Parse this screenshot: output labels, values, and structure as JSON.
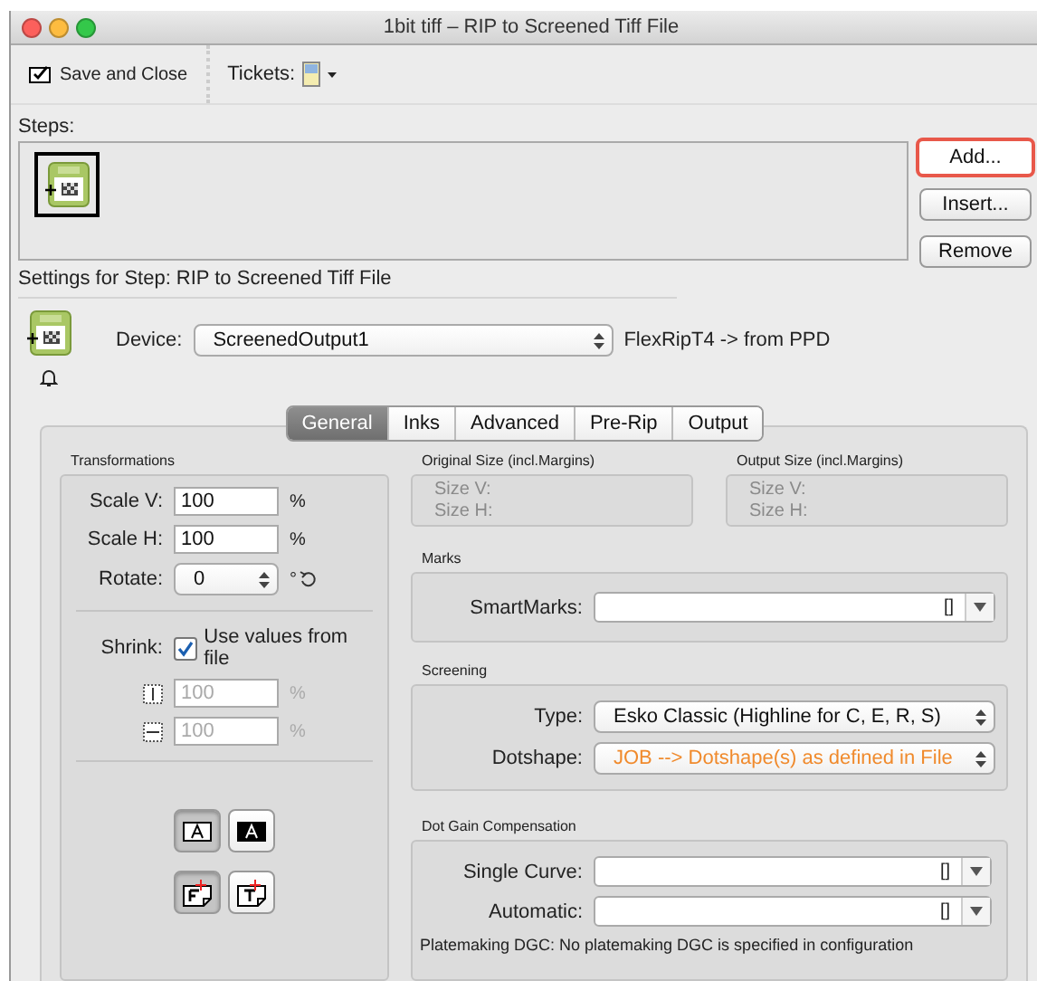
{
  "window": {
    "title": "1bit tiff – RIP to Screened Tiff File"
  },
  "toolbar": {
    "save_close": "Save and Close",
    "tickets": "Tickets:"
  },
  "steps": {
    "label": "Steps:",
    "items": [
      {
        "selected": true
      }
    ],
    "buttons": [
      {
        "label": "Add...",
        "highlighted": true
      },
      {
        "label": "Insert...",
        "highlighted": false
      },
      {
        "label": "Remove",
        "highlighted": false
      }
    ]
  },
  "settings_title": "Settings for Step: RIP to Screened Tiff File",
  "device": {
    "label": "Device:",
    "value": "ScreenedOutput1",
    "note": "FlexRipT4 -> from PPD"
  },
  "tabs": [
    {
      "label": "General",
      "selected": true
    },
    {
      "label": "Inks",
      "selected": false
    },
    {
      "label": "Advanced",
      "selected": false
    },
    {
      "label": "Pre-Rip",
      "selected": false
    },
    {
      "label": "Output",
      "selected": false
    }
  ],
  "transformations": {
    "title": "Transformations",
    "scale": [
      {
        "label": "Scale V:",
        "value": "100",
        "unit": "%"
      },
      {
        "label": "Scale H:",
        "value": "100",
        "unit": "%"
      }
    ],
    "rotate": {
      "label": "Rotate:",
      "value": "0",
      "unit": "°"
    },
    "shrink": {
      "label": "Shrink:",
      "checkbox": "Use values from file",
      "checked": true,
      "fields": [
        {
          "kind": "vertical",
          "value": "100",
          "unit": "%",
          "disabled": true
        },
        {
          "kind": "horizontal",
          "value": "100",
          "unit": "%",
          "disabled": true
        }
      ]
    },
    "toggles": [
      [
        {
          "kind": "outline",
          "selected": true
        },
        {
          "kind": "inverse",
          "selected": false
        }
      ],
      [
        {
          "kind": "mirror-off",
          "selected": true
        },
        {
          "kind": "mirror-on",
          "selected": false
        }
      ]
    ]
  },
  "original_size": {
    "title": "Original Size (incl.Margins)",
    "lines": [
      "Size V:",
      "Size H:"
    ]
  },
  "output_size": {
    "title": "Output Size (incl.Margins)",
    "lines": [
      "Size V:",
      "Size H:"
    ]
  },
  "marks": {
    "title": "Marks",
    "fields": [
      {
        "label": "SmartMarks:",
        "value": "[]"
      }
    ]
  },
  "screening": {
    "title": "Screening",
    "fields": [
      {
        "label": "Type:",
        "value": "Esko Classic (Highline for C, E, R, S)",
        "emphasized": false
      },
      {
        "label": "Dotshape:",
        "value": "JOB --> Dotshape(s) as defined in File",
        "emphasized": true
      }
    ]
  },
  "dgc": {
    "title": "Dot Gain Compensation",
    "fields": [
      {
        "label": "Single Curve:",
        "value": "[]"
      },
      {
        "label": "Automatic:",
        "value": "[]"
      }
    ],
    "note": "Platemaking DGC: No platemaking DGC is specified in configuration"
  }
}
